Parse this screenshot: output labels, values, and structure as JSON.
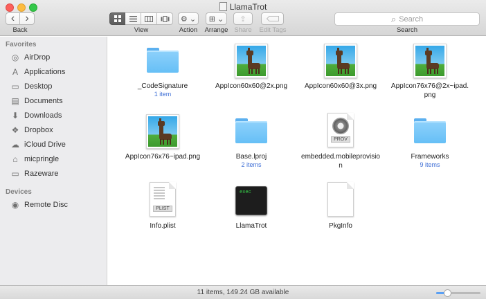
{
  "window": {
    "title": "LlamaTrot"
  },
  "toolbar": {
    "back_label": "Back",
    "view_label": "View",
    "action_label": "Action",
    "arrange_label": "Arrange",
    "share_label": "Share",
    "edit_tags_label": "Edit Tags",
    "search_label": "Search",
    "search_placeholder": "Search",
    "back_glyph": "‹",
    "forward_glyph": "›",
    "action_glyph": "⚙ ⌄",
    "arrange_glyph": "⊞ ⌄",
    "share_glyph": "⇪",
    "search_glyph": "⌕"
  },
  "sidebar": {
    "favorites_heading": "Favorites",
    "devices_heading": "Devices",
    "favorites": [
      {
        "label": "AirDrop",
        "icon": "airdrop-icon",
        "glyph": "◎"
      },
      {
        "label": "Applications",
        "icon": "applications-icon",
        "glyph": "A"
      },
      {
        "label": "Desktop",
        "icon": "desktop-icon",
        "glyph": "▭"
      },
      {
        "label": "Documents",
        "icon": "documents-icon",
        "glyph": "▤"
      },
      {
        "label": "Downloads",
        "icon": "downloads-icon",
        "glyph": "⬇"
      },
      {
        "label": "Dropbox",
        "icon": "dropbox-icon",
        "glyph": "❖"
      },
      {
        "label": "iCloud Drive",
        "icon": "cloud-icon",
        "glyph": "☁"
      },
      {
        "label": "micpringle",
        "icon": "home-icon",
        "glyph": "⌂"
      },
      {
        "label": "Razeware",
        "icon": "folder-icon",
        "glyph": "▭"
      }
    ],
    "devices": [
      {
        "label": "Remote Disc",
        "icon": "disc-icon",
        "glyph": "◉"
      }
    ]
  },
  "files": [
    {
      "name": "_CodeSignature",
      "sub": "1 item",
      "kind": "folder"
    },
    {
      "name": "AppIcon60x60@2x.png",
      "sub": "",
      "kind": "png"
    },
    {
      "name": "AppIcon60x60@3x.png",
      "sub": "",
      "kind": "png"
    },
    {
      "name": "AppIcon76x76@2x~ipad.png",
      "sub": "",
      "kind": "png"
    },
    {
      "name": "AppIcon76x76~ipad.png",
      "sub": "",
      "kind": "png"
    },
    {
      "name": "Base.lproj",
      "sub": "2 items",
      "kind": "folder"
    },
    {
      "name": "embedded.mobileprovision",
      "sub": "",
      "kind": "prov",
      "tag": "PROV"
    },
    {
      "name": "Frameworks",
      "sub": "9 items",
      "kind": "folder"
    },
    {
      "name": "Info.plist",
      "sub": "",
      "kind": "plist",
      "tag": "PLIST"
    },
    {
      "name": "LlamaTrot",
      "sub": "",
      "kind": "exec",
      "tag": "exec"
    },
    {
      "name": "PkgInfo",
      "sub": "",
      "kind": "blank"
    }
  ],
  "status": {
    "text": "11 items, 149.24 GB available",
    "zoom_level": 0.25
  },
  "colors": {
    "accent": "#3f6fd6",
    "folder": "#6cc2f7",
    "sidebar_bg": "#ececee"
  }
}
